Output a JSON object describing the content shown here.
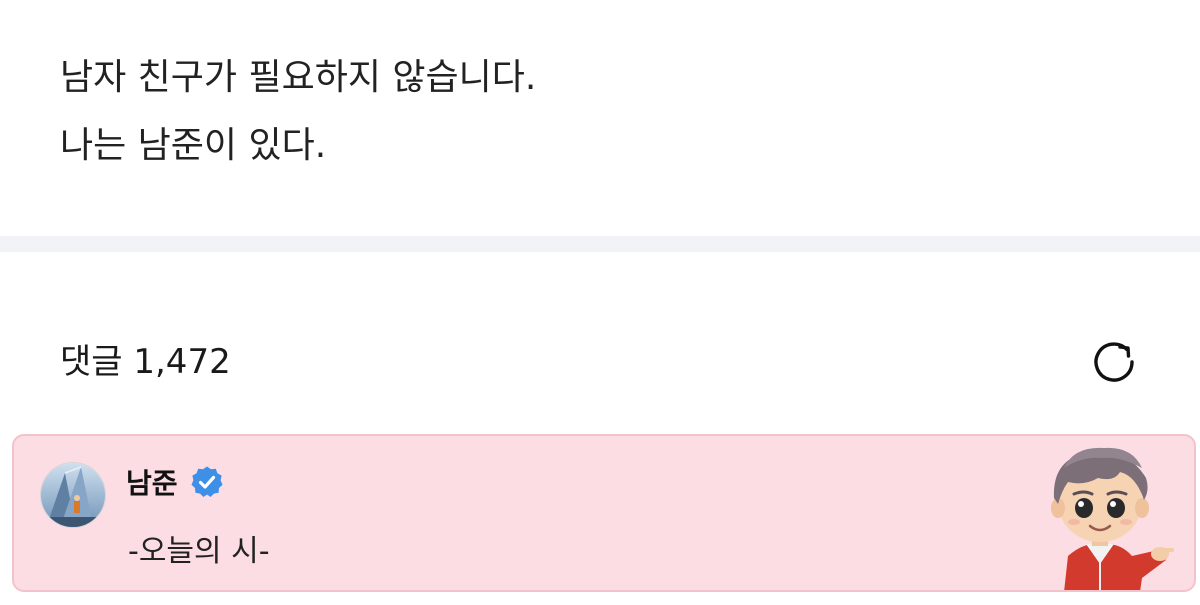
{
  "post": {
    "line1": "남자 친구가 필요하지 않습니다.",
    "line2": "나는 남준이 있다."
  },
  "comments": {
    "header": "댓글 1,472",
    "refresh_icon": "refresh-icon"
  },
  "pinned_comment": {
    "author": "남준",
    "verified": true,
    "text": "-오늘의 시-",
    "card_color": "#fbdde3",
    "badge_color": "#3d8fe8",
    "sticker": "character-sticker"
  }
}
